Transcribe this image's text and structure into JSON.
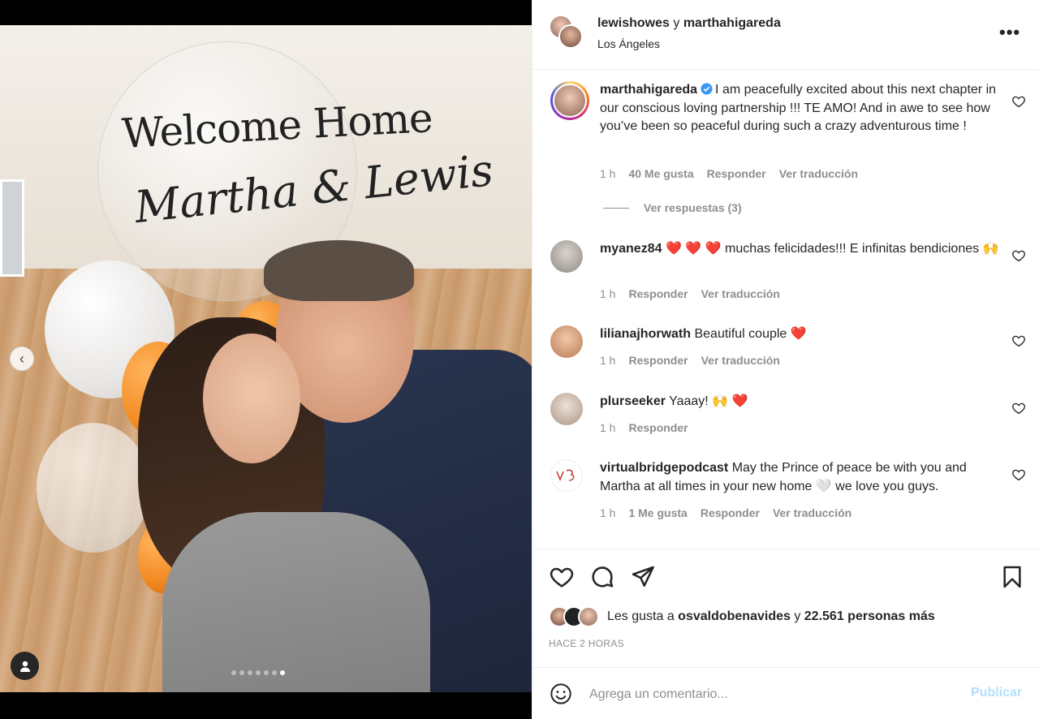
{
  "post": {
    "header": {
      "user1": "lewishowes",
      "conj": " y ",
      "user2": "marthahigareda",
      "location": "Los Ángeles",
      "more": "•••"
    },
    "photo": {
      "balloon_line1": "Welcome Home",
      "balloon_line2": "Martha & Lewis",
      "carousel_dots": 7,
      "active_dot": 7
    },
    "comments": [
      {
        "user": "marthahigareda",
        "verified": true,
        "text": "I am peacefully excited about this next chapter in our conscious loving partnership !!! TE AMO! And in awe to see how you’ve been so peaceful during such a crazy adventurous time !",
        "time": "1 h",
        "likes": "40 Me gusta",
        "reply": "Responder",
        "translate": "Ver traducción",
        "view_replies": "Ver respuestas (3)"
      },
      {
        "user": "myanez84",
        "text": "❤️ ❤️ ❤️ muchas felicidades!!! E infinitas bendiciones 🙌",
        "time": "1 h",
        "reply": "Responder",
        "translate": "Ver traducción"
      },
      {
        "user": "lilianajhorwath",
        "text": "Beautiful couple ❤️",
        "time": "1 h",
        "reply": "Responder",
        "translate": "Ver traducción"
      },
      {
        "user": "plurseeker",
        "text": "Yaaay! 🙌 ❤️",
        "time": "1 h",
        "reply": "Responder"
      },
      {
        "user": "virtualbridgepodcast",
        "text": "May the Prince of peace be with you and Martha at all times in your new home 🤍 we love you guys.",
        "time": "1 h",
        "likes": "1 Me gusta",
        "reply": "Responder",
        "translate": "Ver traducción"
      }
    ],
    "likes": {
      "prefix": "Les gusta a ",
      "user": "osvaldobenavides",
      "middle": " y ",
      "count": "22.561 personas más"
    },
    "time_ago": "HACE 2 HORAS",
    "composer": {
      "placeholder": "Agrega un comentario...",
      "publish": "Publicar"
    }
  }
}
